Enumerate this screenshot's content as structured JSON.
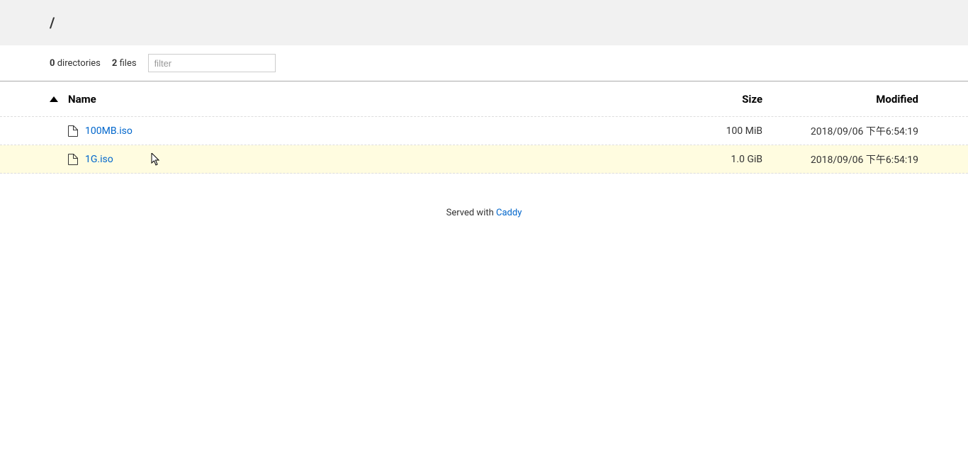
{
  "breadcrumb": "/",
  "stats": {
    "dir_count": "0",
    "dir_label": "directories",
    "file_count": "2",
    "file_label": "files"
  },
  "filter": {
    "placeholder": "filter",
    "value": ""
  },
  "columns": {
    "name": "Name",
    "size": "Size",
    "modified": "Modified"
  },
  "files": [
    {
      "name": "100MB.iso",
      "size": "100 MiB",
      "modified": "2018/09/06 下午6:54:19",
      "hovered": false
    },
    {
      "name": "1G.iso",
      "size": "1.0 GiB",
      "modified": "2018/09/06 下午6:54:19",
      "hovered": true
    }
  ],
  "footer": {
    "text": "Served with ",
    "link_text": "Caddy"
  }
}
